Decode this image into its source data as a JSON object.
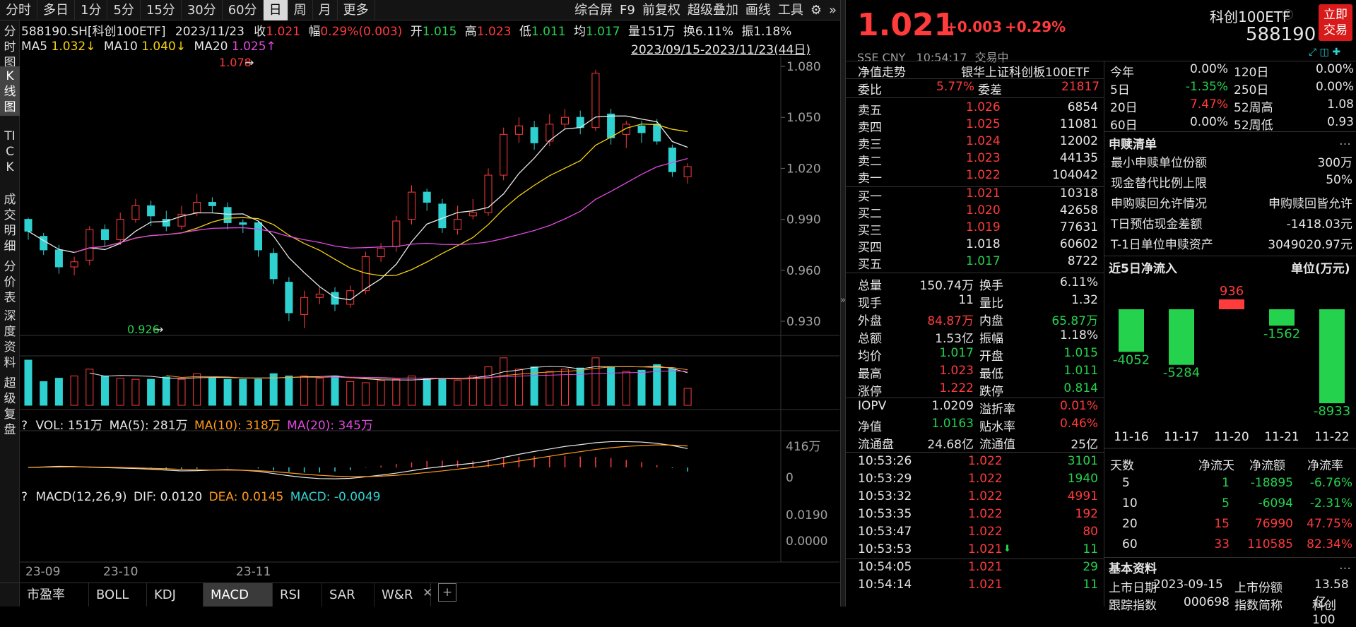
{
  "toolbar": {
    "items": [
      "分时",
      "多日",
      "1分",
      "5分",
      "15分",
      "30分",
      "60分",
      "日",
      "周",
      "月",
      "更多"
    ],
    "active": "日",
    "right": [
      "综合屏",
      "F9",
      "前复权",
      "超级叠加",
      "画线",
      "工具"
    ]
  },
  "leftnav": [
    "分时图",
    "K线图",
    "TICK",
    "成交明细",
    "分价表",
    "深度资料",
    "超级复盘"
  ],
  "info": {
    "code": "588190.SH[科创100ETF]",
    "date": "2023/11/23",
    "close_l": "收",
    "close": "1.021",
    "amp_l": "幅",
    "amp": "0.29%(0.003)",
    "open_l": "开",
    "open": "1.015",
    "high_l": "高",
    "high": "1.023",
    "low_l": "低",
    "low": "1.011",
    "avg_l": "均",
    "avg": "1.017",
    "vol_l": "量",
    "vol": "151万",
    "turn_l": "换",
    "turn": "6.11%",
    "swing_l": "振",
    "swing": "1.18%"
  },
  "ma": {
    "ma5": "MA5",
    "ma5v": "1.032↓",
    "ma10": "MA10",
    "ma10v": "1.040↓",
    "ma20": "MA20",
    "ma20v": "1.025↑",
    "range": "2023/09/15-2023/11/23(44日)"
  },
  "kline": {
    "yticks": [
      "1.080",
      "1.050",
      "1.020",
      "0.990",
      "0.960",
      "0.930"
    ],
    "hi_label": "1.078",
    "lo_label": "0.926"
  },
  "volpanel": {
    "header_q": "?",
    "vol": "VOL: 151万",
    "ma5": "MA(5): 281万",
    "ma10": "MA(10): 318万",
    "ma20": "MA(20): 345万",
    "ytop": "416万",
    "ybot": "0"
  },
  "macdpanel": {
    "header_q": "?",
    "name": "MACD(12,26,9)",
    "dif": "DIF: 0.0120",
    "dea": "DEA: 0.0145",
    "macd": "MACD: -0.0049",
    "ytop": "0.0190",
    "ybot": "0.0000"
  },
  "xaxis": [
    "23-09",
    "23-10",
    "23-11"
  ],
  "bottomtabs": [
    "市盈率",
    "BOLL",
    "KDJ",
    "MACD",
    "RSI",
    "SAR",
    "W&R"
  ],
  "bottom_active": "MACD",
  "quote": {
    "price": "1.021",
    "chg": "+0.003",
    "pct": "+0.29%",
    "name": "科创100ETF",
    "code": "588190",
    "trade_btn": "立即交易",
    "exch": "SSE",
    "cur": "CNY",
    "time": "10:54:17",
    "status": "交易中"
  },
  "nav": {
    "label": "净值走势",
    "index": "银华上证科创板100ETF"
  },
  "weibi": {
    "l1": "委比",
    "v1": "5.77%",
    "l2": "委差",
    "v2": "21817"
  },
  "sells": [
    [
      "卖五",
      "1.026",
      "6854"
    ],
    [
      "卖四",
      "1.025",
      "11081"
    ],
    [
      "卖三",
      "1.024",
      "12002"
    ],
    [
      "卖二",
      "1.023",
      "44135"
    ],
    [
      "卖一",
      "1.022",
      "104042"
    ]
  ],
  "buys": [
    [
      "买一",
      "1.021",
      "10318"
    ],
    [
      "买二",
      "1.020",
      "42658"
    ],
    [
      "买三",
      "1.019",
      "77631"
    ],
    [
      "买四",
      "1.018",
      "60602"
    ],
    [
      "买五",
      "1.017",
      "8722"
    ]
  ],
  "stats": [
    [
      "总量",
      "150.74万",
      "换手",
      "6.11%"
    ],
    [
      "现手",
      "11",
      "量比",
      "1.32"
    ],
    [
      "外盘",
      "84.87万",
      "内盘",
      "65.87万"
    ],
    [
      "总额",
      "1.53亿",
      "振幅",
      "1.18%"
    ],
    [
      "均价",
      "1.017",
      "开盘",
      "1.015"
    ],
    [
      "最高",
      "1.023",
      "最低",
      "1.011"
    ],
    [
      "涨停",
      "1.222",
      "跌停",
      "0.814"
    ],
    [
      "IOPV",
      "1.0209",
      "溢折率",
      "0.01%"
    ],
    [
      "净值",
      "1.0163",
      "贴水率",
      "0.46%"
    ],
    [
      "流通盘",
      "24.68亿",
      "流通值",
      "25亿"
    ]
  ],
  "ticks": [
    [
      "10:53:26",
      "1.022",
      "3101"
    ],
    [
      "10:53:29",
      "1.022",
      "1940"
    ],
    [
      "10:53:32",
      "1.022",
      "4991"
    ],
    [
      "10:53:35",
      "1.022",
      "192"
    ],
    [
      "10:53:47",
      "1.022",
      "80"
    ],
    [
      "10:53:53",
      "1.021",
      "11"
    ],
    [
      "10:54:05",
      "1.021",
      "29"
    ],
    [
      "10:54:14",
      "1.021",
      "11"
    ]
  ],
  "perf": [
    [
      "今年",
      "0.00%",
      "120日",
      "0.00%"
    ],
    [
      "5日",
      "-1.35%",
      "250日",
      "0.00%"
    ],
    [
      "20日",
      "7.47%",
      "52周高",
      "1.08"
    ],
    [
      "60日",
      "0.00%",
      "52周低",
      "0.93"
    ]
  ],
  "sg": {
    "title": "申赎清单",
    "rows": [
      [
        "最小申赎单位份额",
        "300万"
      ],
      [
        "现金替代比例上限",
        "50%"
      ],
      [
        "申购赎回允许情况",
        "申购赎回皆允许"
      ],
      [
        "T日预估现金差额",
        "-1418.03元"
      ],
      [
        "T-1日单位申赎资产",
        "3049020.97元"
      ]
    ]
  },
  "flow": {
    "title": "近5日净流入",
    "unit": "单位(万元)"
  },
  "chart_data": {
    "type": "bar",
    "categories": [
      "11-16",
      "11-17",
      "11-20",
      "11-21",
      "11-22"
    ],
    "values": [
      -4052,
      -5284,
      936,
      -1562,
      -8933
    ]
  },
  "flowtbl": {
    "headers": [
      "天数",
      "净流天",
      "净流额",
      "净流率"
    ],
    "rows": [
      [
        "5",
        "1",
        "-18895",
        "-6.76%"
      ],
      [
        "10",
        "5",
        "-6094",
        "-2.31%"
      ],
      [
        "20",
        "15",
        "76990",
        "47.75%"
      ],
      [
        "60",
        "33",
        "110585",
        "82.34%"
      ]
    ]
  },
  "basic": {
    "title": "基本资料",
    "l1": "上市日期",
    "v1": "2023-09-15",
    "l2": "上市份额",
    "v2": "13.58亿",
    "l3": "跟踪指数",
    "v3": "000698",
    "l4": "指数简称",
    "v4": "科创100"
  }
}
